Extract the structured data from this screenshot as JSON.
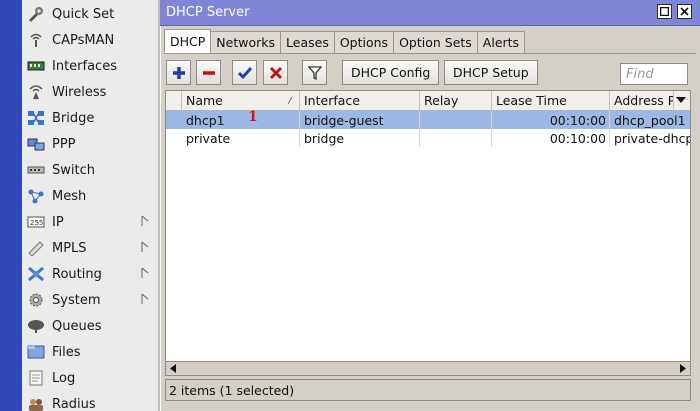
{
  "sidebar": {
    "items": [
      {
        "label": "Quick Set",
        "icon": "quick-set-icon",
        "submenu": false
      },
      {
        "label": "CAPsMAN",
        "icon": "capsman-icon",
        "submenu": false
      },
      {
        "label": "Interfaces",
        "icon": "interfaces-icon",
        "submenu": false
      },
      {
        "label": "Wireless",
        "icon": "wireless-icon",
        "submenu": false
      },
      {
        "label": "Bridge",
        "icon": "bridge-icon",
        "submenu": false
      },
      {
        "label": "PPP",
        "icon": "ppp-icon",
        "submenu": false
      },
      {
        "label": "Switch",
        "icon": "switch-icon",
        "submenu": false
      },
      {
        "label": "Mesh",
        "icon": "mesh-icon",
        "submenu": false
      },
      {
        "label": "IP",
        "icon": "ip-icon",
        "submenu": true
      },
      {
        "label": "MPLS",
        "icon": "mpls-icon",
        "submenu": true
      },
      {
        "label": "Routing",
        "icon": "routing-icon",
        "submenu": true
      },
      {
        "label": "System",
        "icon": "system-icon",
        "submenu": true
      },
      {
        "label": "Queues",
        "icon": "queues-icon",
        "submenu": false
      },
      {
        "label": "Files",
        "icon": "files-icon",
        "submenu": false
      },
      {
        "label": "Log",
        "icon": "log-icon",
        "submenu": false
      },
      {
        "label": "Radius",
        "icon": "radius-icon",
        "submenu": false
      }
    ]
  },
  "window": {
    "title": "DHCP Server",
    "tabs": [
      {
        "label": "DHCP",
        "active": true
      },
      {
        "label": "Networks",
        "active": false
      },
      {
        "label": "Leases",
        "active": false
      },
      {
        "label": "Options",
        "active": false
      },
      {
        "label": "Option Sets",
        "active": false
      },
      {
        "label": "Alerts",
        "active": false
      }
    ],
    "toolbar": {
      "dhcp_config_label": "DHCP Config",
      "dhcp_setup_label": "DHCP Setup",
      "find_placeholder": "Find"
    },
    "table": {
      "columns": [
        "Name",
        "Interface",
        "Relay",
        "Lease Time",
        "Address P"
      ],
      "rows": [
        {
          "name": "dhcp1",
          "interface": "bridge-guest",
          "relay": "",
          "lease_time": "00:10:00",
          "address_pool": "dhcp_pool1",
          "selected": true
        },
        {
          "name": "private",
          "interface": "bridge",
          "relay": "",
          "lease_time": "00:10:00",
          "address_pool": "private-dhcp",
          "selected": false
        }
      ],
      "marker": "1"
    },
    "status": "2 items (1 selected)"
  },
  "colors": {
    "titlebar": "#7f86d6",
    "selected_row": "#9bb9e4",
    "left_strip": "#2f47b9",
    "marker": "#e0101e"
  }
}
